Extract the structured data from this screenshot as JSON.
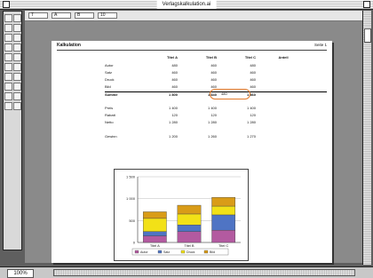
{
  "window": {
    "title": "Verlagskalkulation.ai",
    "zoom": "100%"
  },
  "toolbar": {
    "fields": [
      "T",
      "A",
      "B",
      "10"
    ]
  },
  "palette": {
    "tools": [
      "arrow",
      "select",
      "pen",
      "text",
      "brush",
      "pencil",
      "rect",
      "ellipse",
      "rotate",
      "scale",
      "reflect",
      "shear",
      "blend",
      "gradient",
      "eyedropper",
      "hand",
      "zoom",
      "fill",
      "stroke",
      "swap"
    ]
  },
  "document": {
    "title": "Kalkulation",
    "page_label": "Seite 1",
    "table": {
      "headers": [
        "",
        "Titel A",
        "Titel B",
        "Titel C",
        "Anteil"
      ],
      "rows": [
        {
          "label": "Autor",
          "c1": "480",
          "c2": "460",
          "c3": "480",
          "c4": ""
        },
        {
          "label": "Satz",
          "c1": "460",
          "c2": "460",
          "c3": "460",
          "c4": ""
        },
        {
          "label": "Druck",
          "c1": "460",
          "c2": "460",
          "c3": "460",
          "c4": ""
        },
        {
          "label": "Bild",
          "c1": "460",
          "c2": "460",
          "c3": "460",
          "c4": ""
        },
        {
          "label": "Summe",
          "c1": "1 800",
          "c2": "1 840",
          "c3": "1 860",
          "c4": "",
          "total": true
        },
        {
          "label": "",
          "c1": "",
          "c2": "",
          "c3": "",
          "c4": ""
        },
        {
          "label": "Preis",
          "c1": "1 400",
          "c2": "1 400",
          "c3": "1 400",
          "c4": ""
        },
        {
          "label": "Rabatt",
          "c1": "120",
          "c2": "120",
          "c3": "120",
          "c4": ""
        },
        {
          "label": "Netto",
          "c1": "1 280",
          "c2": "1 280",
          "c3": "1 280",
          "c4": ""
        },
        {
          "label": "",
          "c1": "",
          "c2": "",
          "c3": "",
          "c4": ""
        },
        {
          "label": "Gewinn",
          "c1": "1 200",
          "c2": "1 260",
          "c3": "1 270",
          "c4": ""
        }
      ],
      "highlighted_value": "480"
    }
  },
  "chart_data": {
    "type": "bar",
    "stacked": true,
    "categories": [
      "Titel A",
      "Titel B",
      "Titel C"
    ],
    "ylim": [
      0,
      1500
    ],
    "yticks": [
      "0",
      "500",
      "1 000",
      "1 500"
    ],
    "series": [
      {
        "name": "Autor",
        "color": "#b35aa0",
        "values": [
          150,
          250,
          280
        ]
      },
      {
        "name": "Satz",
        "color": "#4f74c4",
        "values": [
          100,
          150,
          350
        ]
      },
      {
        "name": "Druck",
        "color": "#f2e117",
        "values": [
          300,
          250,
          200
        ]
      },
      {
        "name": "Bild",
        "color": "#d99c18",
        "values": [
          150,
          200,
          200
        ]
      }
    ],
    "legend_position": "bottom"
  }
}
